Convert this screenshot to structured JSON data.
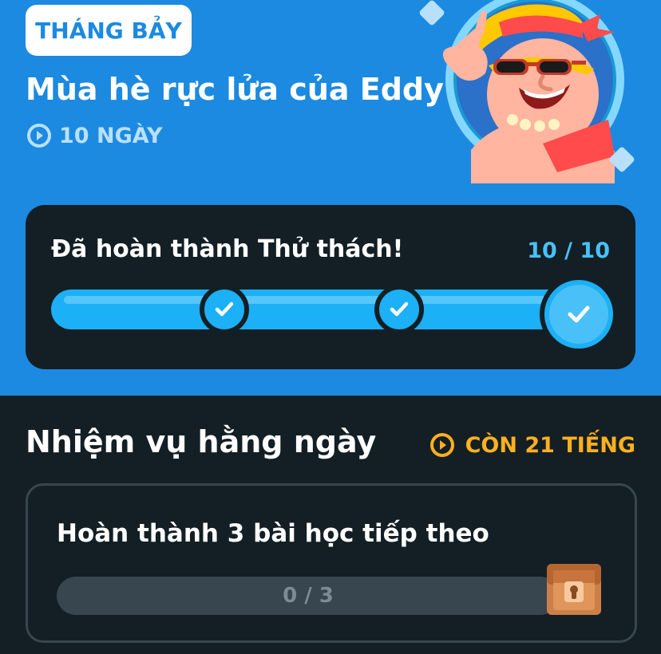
{
  "event": {
    "month_badge": "THÁNG BẢY",
    "title": "Mùa hè rực lửa của Eddy",
    "duration": "10 NGÀY",
    "icons": {
      "duration": "clock-icon",
      "avatar": "eddy-character-avatar"
    }
  },
  "challenge": {
    "status": "Đã hoàn thành Thử thách!",
    "progress_text": "10 / 10",
    "progress_fraction": 1.0,
    "milestones": [
      "check-icon",
      "check-icon",
      "check-icon"
    ]
  },
  "daily_quests": {
    "title": "Nhiệm vụ hằng ngày",
    "time_left": "CÒN 21 TIẾNG",
    "items": [
      {
        "title": "Hoàn thành 3 bài học tiếp theo",
        "progress_text": "0 / 3",
        "progress_fraction": 0,
        "reward_icon": "treasure-chest-icon"
      }
    ]
  },
  "colors": {
    "hero_blue": "#1c8ae0",
    "dark_bg": "#131f24",
    "progress_blue": "#1cb0f6",
    "timer_orange": "#ffb020",
    "empty_bar": "#37464f"
  }
}
